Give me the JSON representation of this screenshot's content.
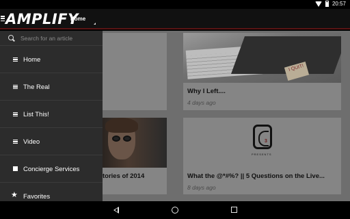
{
  "status_bar": {
    "time": "20:57"
  },
  "app_bar": {
    "brand": "AMPLIFY",
    "section": "Home"
  },
  "drawer": {
    "search": {
      "placeholder": "Search for an article"
    },
    "items": [
      {
        "label": "Home",
        "icon": "list-icon"
      },
      {
        "label": "The Real",
        "icon": "list-icon"
      },
      {
        "label": "List This!",
        "icon": "list-icon"
      },
      {
        "label": "Video",
        "icon": "list-icon"
      },
      {
        "label": "Concierge Services",
        "icon": "square-icon"
      },
      {
        "label": "Favorites",
        "icon": "star-icon"
      }
    ]
  },
  "articles": [
    {
      "title": "Why I Left....",
      "time": "4 days ago",
      "thumbnail_note": "I QUIT!"
    },
    {
      "title": "tories of 2014",
      "time": ""
    },
    {
      "title": "What the @*#%? || 5 Questions on the Live...",
      "time": "8 days ago",
      "logo_text": "3",
      "logo_sub": "PRESENTS"
    }
  ]
}
